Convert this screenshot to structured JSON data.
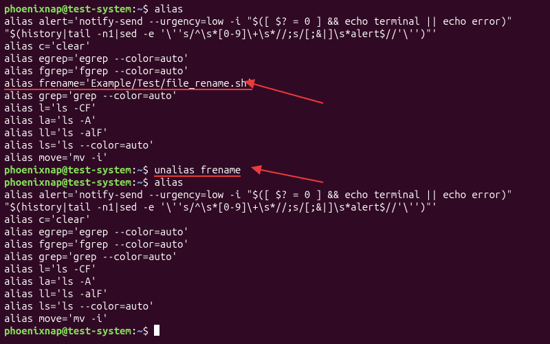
{
  "prompt": {
    "user": "phoenixnap",
    "at": "@",
    "host": "test-system",
    "colon": ":",
    "path": "~",
    "sigil": "$ "
  },
  "cmd1": "alias",
  "out1": [
    "alias alert='notify-send --urgency=low -i \"$([ $? = 0 ] && echo terminal || echo error)\"",
    "\"$(history|tail -n1|sed -e '\\''s/^\\s*[0-9]\\+\\s*//;s/[;&|]\\s*alert$//'\\'')\"'",
    "alias c='clear'",
    "alias egrep='egrep --color=auto'",
    "alias fgrep='fgrep --color=auto'"
  ],
  "out1_hl": "alias frename='Example/Test/file_rename.sh'",
  "out1b": [
    "alias grep='grep --color=auto'",
    "alias l='ls -CF'",
    "alias la='ls -A'",
    "alias ll='ls -alF'",
    "alias ls='ls --color=auto'",
    "alias move='mv -i'"
  ],
  "cmd2": "unalias frename",
  "cmd3": "alias",
  "out2": [
    "alias alert='notify-send --urgency=low -i \"$([ $? = 0 ] && echo terminal || echo error)\"",
    "\"$(history|tail -n1|sed -e '\\''s/^\\s*[0-9]\\+\\s*//;s/[;&|]\\s*alert$//'\\'')\"'",
    "alias c='clear'",
    "alias egrep='egrep --color=auto'",
    "alias fgrep='fgrep --color=auto'",
    "alias grep='grep --color=auto'",
    "alias l='ls -CF'",
    "alias la='ls -A'",
    "alias ll='ls -alF'",
    "alias ls='ls --color=auto'",
    "alias move='mv -i'"
  ],
  "arrow_color": "#ed3a3a"
}
